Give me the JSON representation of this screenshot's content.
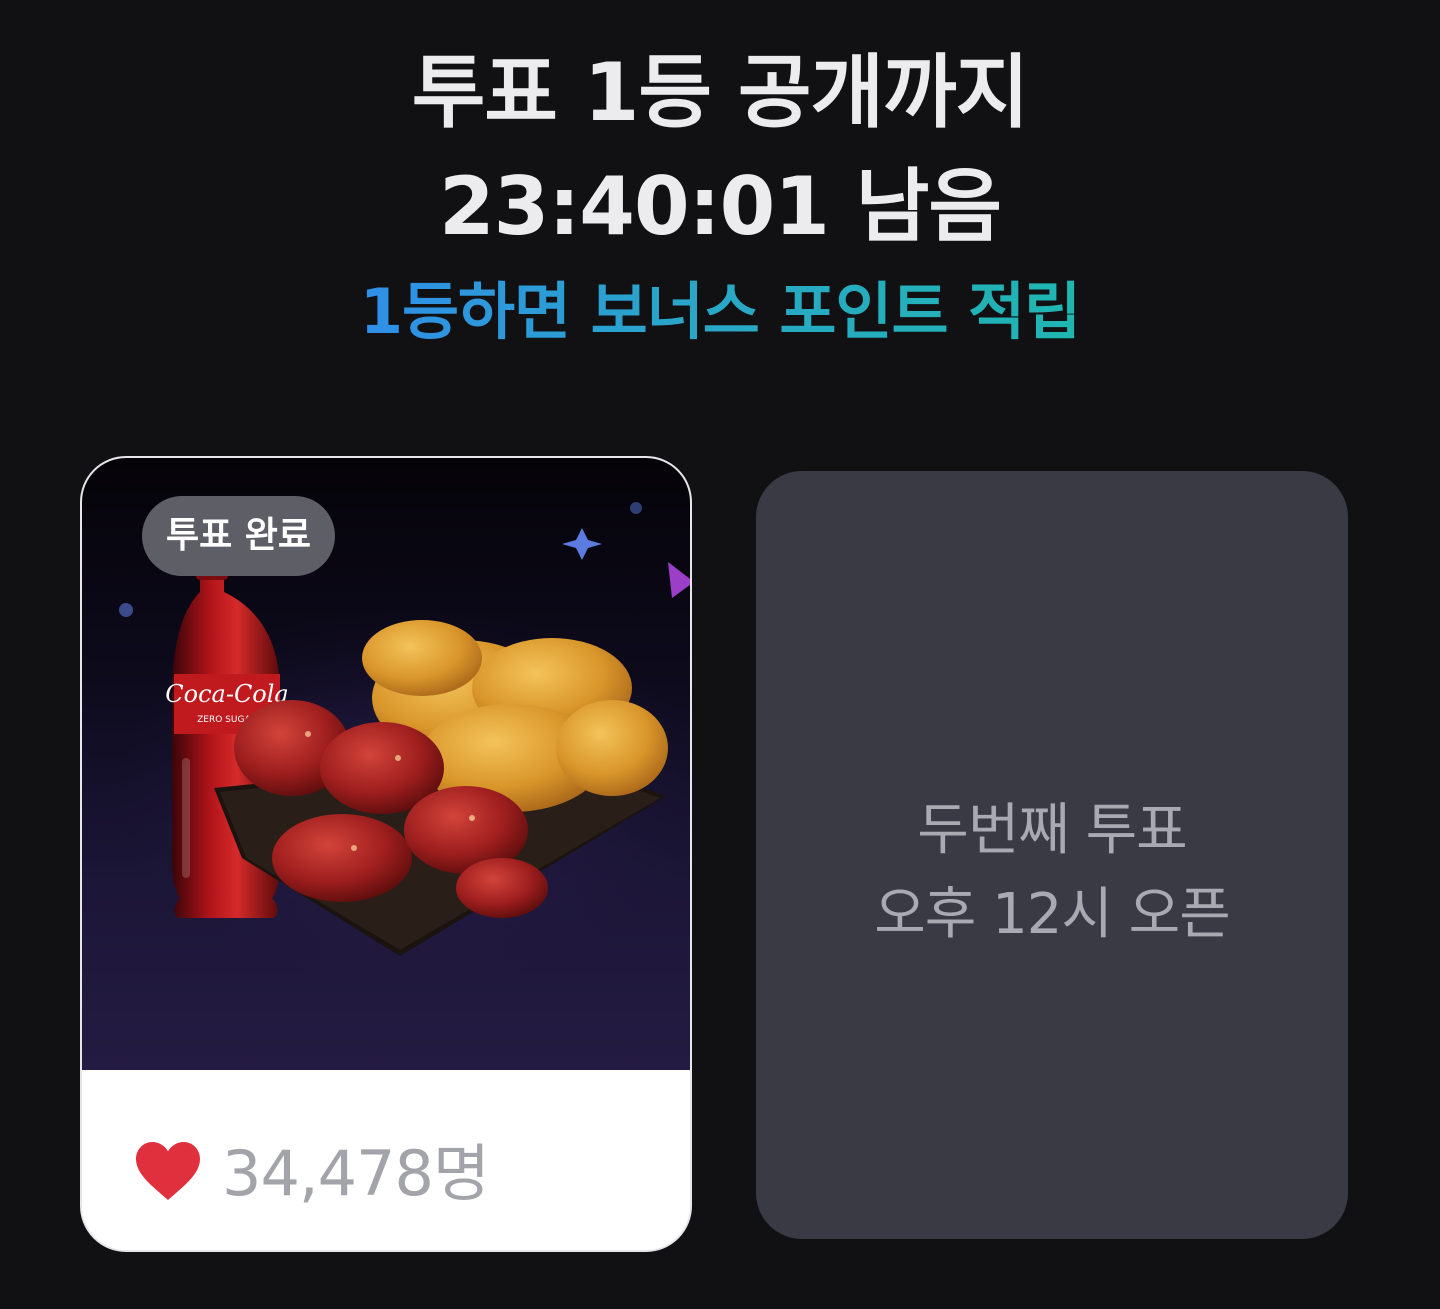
{
  "header": {
    "title_line1": "투표 1등 공개까지",
    "title_line2": "23:40:01 남음",
    "bonus_line": "1등하면 보너스 포인트 적립"
  },
  "vote_card": {
    "badge": "투표 완료",
    "count": "34,478명",
    "image_product": "Coca-Cola",
    "image_product_sub": "ZERO SUGAR"
  },
  "locked_card": {
    "line1": "두번째 투표",
    "line2": "오후 12시 오픈"
  },
  "colors": {
    "background": "#111114",
    "heart": "#e0303e",
    "bonus_gradient_start": "#2f8fe8",
    "bonus_gradient_end": "#1fb6b0",
    "locked_card": "#3a3a45"
  },
  "icons": {
    "like": "heart-icon"
  }
}
